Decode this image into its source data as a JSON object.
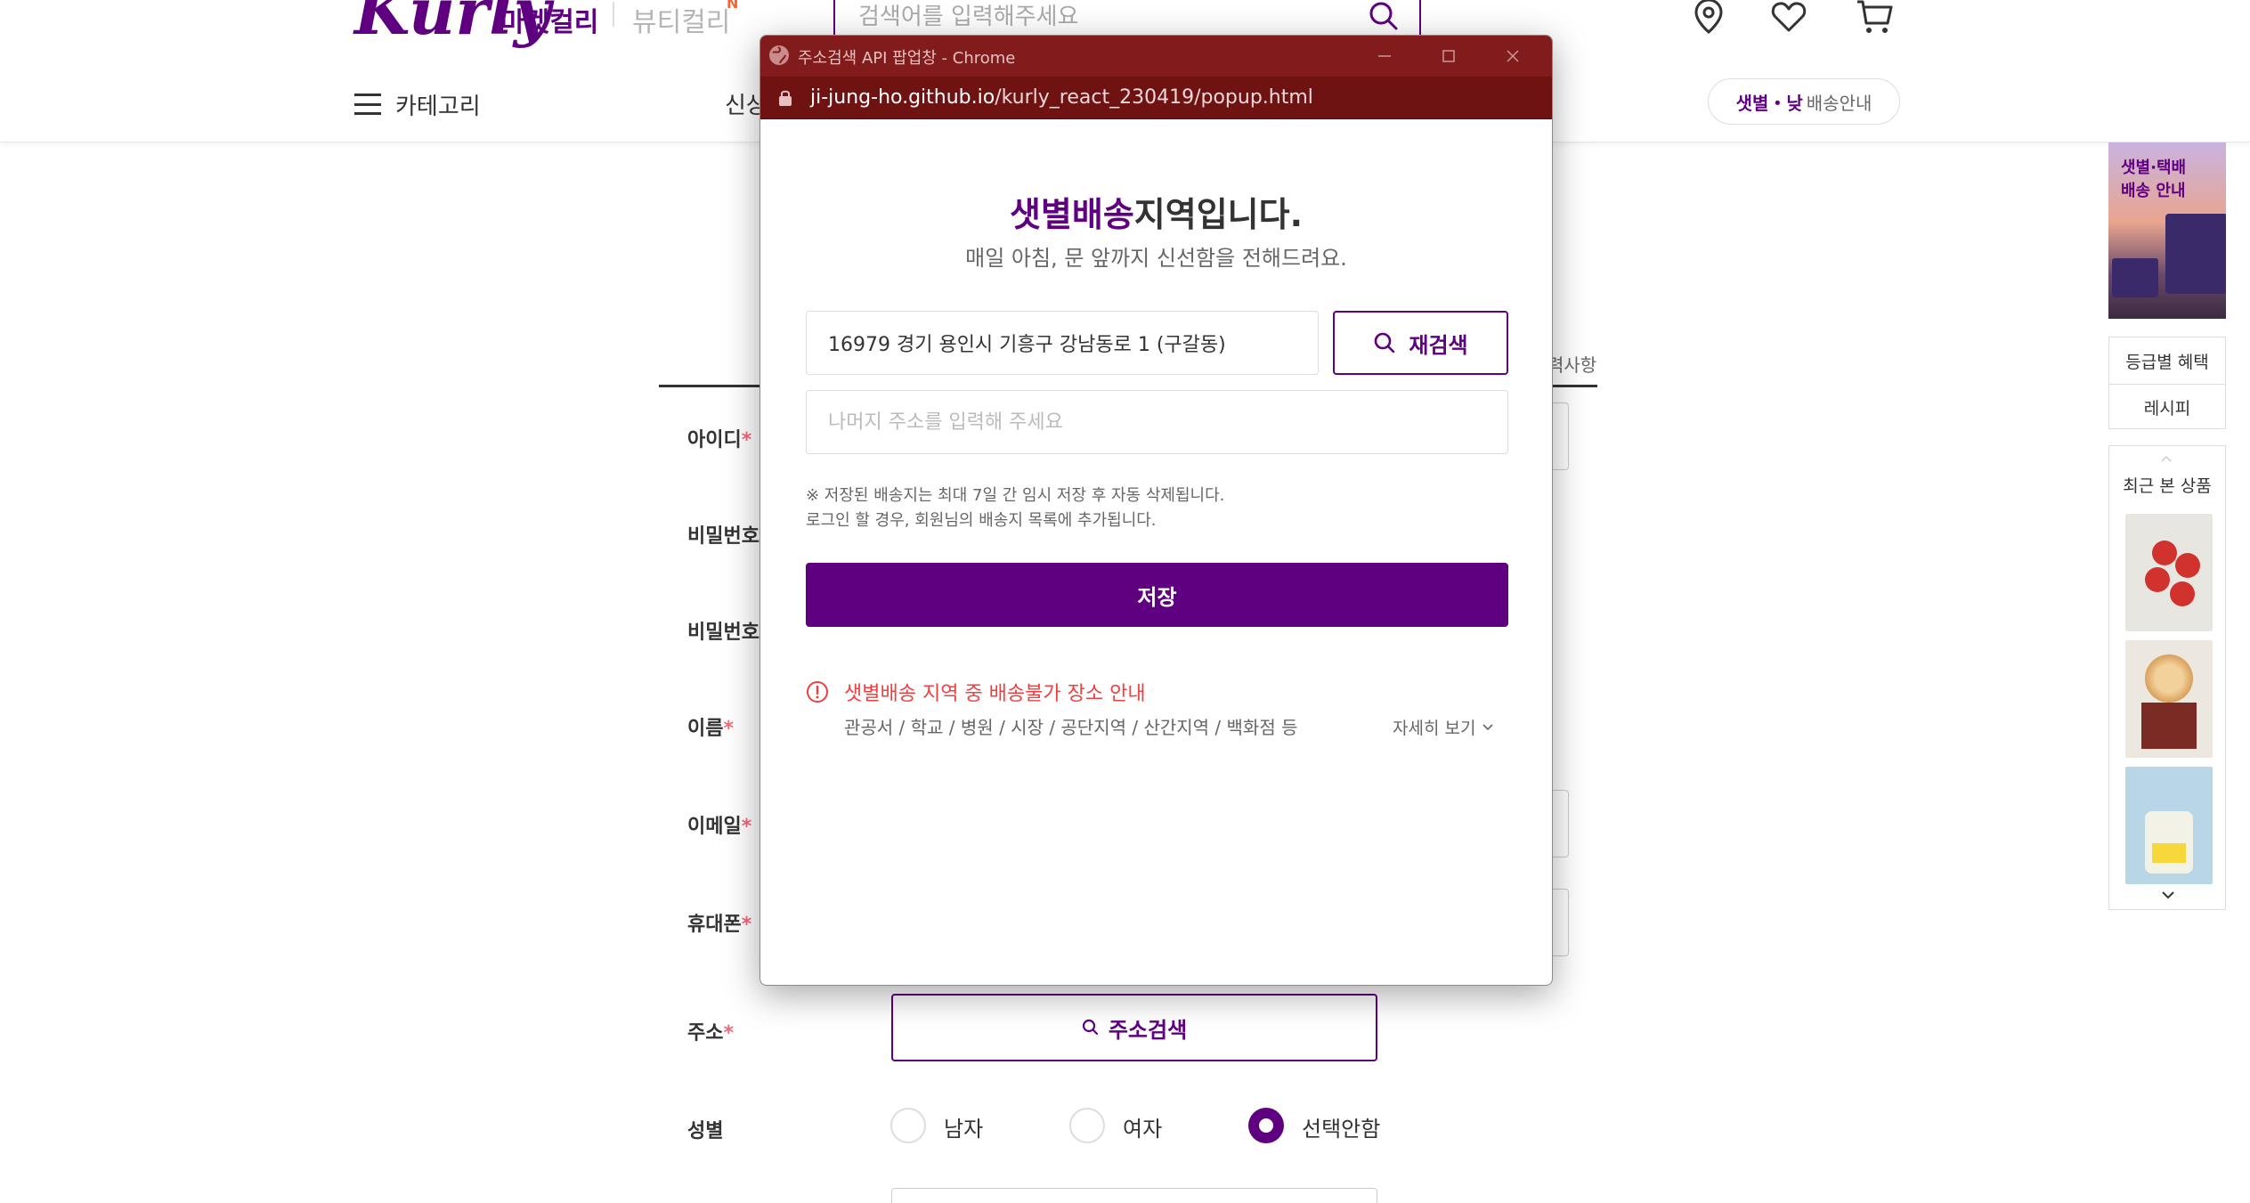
{
  "header": {
    "logo": "Kurly",
    "market_link": "마켓컬리",
    "beauty_link": "뷰티컬리",
    "beauty_badge": "N",
    "search_placeholder": "검색어를 입력해주세요",
    "category_label": "카테고리",
    "nav_partial": "신상",
    "delivery_pill_purple": "샛별・낮",
    "delivery_pill_rest": "배송안내"
  },
  "form": {
    "required_note": "력사항",
    "labels": {
      "id": "아이디",
      "password": "비밀번호",
      "password_confirm": "비밀번호",
      "name": "이름",
      "email": "이메일",
      "phone": "휴대폰",
      "address": "주소",
      "gender": "성별"
    },
    "required_mark": "*",
    "address_search_button": "주소검색",
    "gender_options": [
      {
        "label": "남자",
        "checked": false
      },
      {
        "label": "여자",
        "checked": false
      },
      {
        "label": "선택안함",
        "checked": true
      }
    ]
  },
  "side": {
    "banner_line1": "샛별·택배",
    "banner_line2": "배송 안내",
    "links": [
      "등급별 혜택",
      "레시피"
    ],
    "recent_title": "최근 본 상품"
  },
  "popup": {
    "window_title": "주소검색 API 팝업창 - Chrome",
    "url_host": "ji-jung-ho.github.io",
    "url_path": "/kurly_react_230419/popup.html",
    "title_purple": "샛별배송",
    "title_rest": "지역입니다.",
    "subtitle": "매일 아침, 문 앞까지 신선함을 전해드려요.",
    "address_value": "16979 경기 용인시 기흥구 강남동로 1 (구갈동)",
    "research_button": "재검색",
    "detail_placeholder": "나머지 주소를 입력해 주세요",
    "notice_line1": "※ 저장된 배송지는 최대 7일 간 임시 저장 후 자동 삭제됩니다.",
    "notice_line2": "로그인 할 경우, 회원님의 배송지 목록에 추가됩니다.",
    "save_button": "저장",
    "warning_title": "샛별배송 지역 중 배송불가 장소 안내",
    "warning_places": "관공서 / 학교 / 병원 / 시장 / 공단지역 / 산간지역 / 백화점 등",
    "more_link": "자세히 보기"
  },
  "colors": {
    "brand_purple": "#5f0080",
    "titlebar": "#821c1c",
    "warning_red": "#f03f40"
  }
}
